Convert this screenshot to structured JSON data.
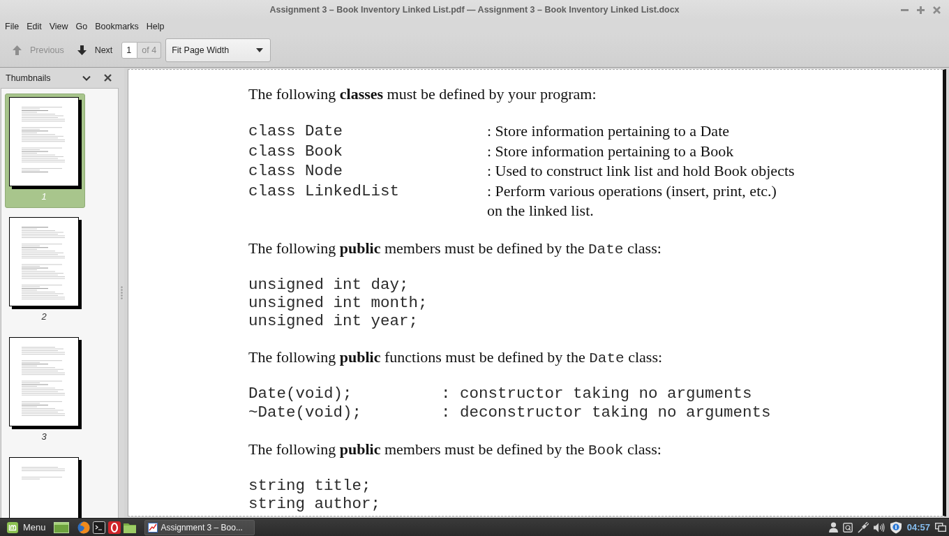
{
  "window": {
    "title": "Assignment 3 – Book Inventory Linked List.pdf — Assignment 3 – Book Inventory Linked List.docx"
  },
  "menu_bar": [
    "File",
    "Edit",
    "View",
    "Go",
    "Bookmarks",
    "Help"
  ],
  "toolbar": {
    "previous": {
      "label": "Previous",
      "disabled": true
    },
    "next": {
      "label": "Next",
      "disabled": false
    },
    "page_entry": {
      "value": "1",
      "total": "of 4"
    },
    "zoom": {
      "value": "Fit Page Width"
    }
  },
  "sidebar": {
    "title": "Thumbnails",
    "thumbnails": [
      {
        "label": "1",
        "selected": true
      },
      {
        "label": "2",
        "selected": false
      },
      {
        "label": "3",
        "selected": false
      },
      {
        "selected": false
      }
    ]
  },
  "document": {
    "blocks": [
      {
        "kind": "paragraph",
        "parts": [
          {
            "kind": "text",
            "text": "The following **classes** must be defined by your program:"
          }
        ]
      },
      {
        "kind": "definitions",
        "items": [
          {
            "term": "class Date",
            "description": ": Store information pertaining to a Date"
          },
          {
            "term": "class Book",
            "description": ": Store information pertaining to a Book"
          },
          {
            "term": "class Node",
            "description": ": Used to construct link list and hold Book objects"
          },
          {
            "term": "class LinkedList",
            "description": ": Perform various operations (insert, print, etc.)\non the linked list."
          }
        ]
      },
      {
        "kind": "paragraph",
        "parts": [
          {
            "kind": "text",
            "text": "The following **public** members must be defined by the "
          },
          {
            "kind": "code",
            "text": "Date"
          },
          {
            "kind": "text",
            "text": " class:"
          }
        ]
      },
      {
        "kind": "code",
        "lines": [
          "unsigned int day;",
          "unsigned int month;",
          "unsigned int year;"
        ]
      },
      {
        "kind": "paragraph",
        "parts": [
          {
            "kind": "text",
            "text": "The following **public** functions must be defined by the "
          },
          {
            "kind": "code",
            "text": "Date"
          },
          {
            "kind": "text",
            "text": " class:"
          }
        ]
      },
      {
        "kind": "signatures",
        "items": [
          {
            "term": "Date(void);",
            "description": ": constructor taking no arguments"
          },
          {
            "term": "~Date(void);",
            "description": ": deconstructor taking no arguments"
          }
        ]
      },
      {
        "kind": "paragraph",
        "parts": [
          {
            "kind": "text",
            "text": "The following **public** members must be defined by the "
          },
          {
            "kind": "code",
            "text": "Book"
          },
          {
            "kind": "text",
            "text": " class:"
          }
        ]
      },
      {
        "kind": "code",
        "lines": [
          "string title;",
          "string author;"
        ]
      }
    ]
  },
  "taskbar": {
    "menu": {
      "label": "Menu"
    },
    "windows": [
      {
        "label": "Assignment 3 – Boo...",
        "selected": true
      }
    ],
    "clock": "04:57"
  }
}
